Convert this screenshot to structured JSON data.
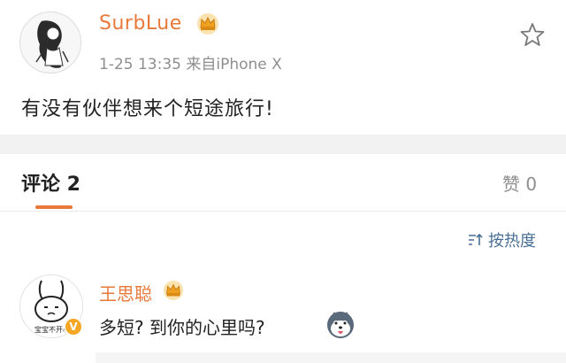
{
  "post": {
    "username": "SurbLue",
    "meta": "1-25 13:35  来自iPhone X",
    "text": "有没有伙伴想来个短途旅行!"
  },
  "comments_section": {
    "tab_label": "评论 2",
    "likes_label": "赞 0",
    "sort_label": "按热度"
  },
  "comment": {
    "name": "王思聪",
    "text": "多短? 到你的心里吗?",
    "avatar_caption": "宝宝不开心"
  },
  "colors": {
    "accent": "#e8793a",
    "link": "#4a6f96",
    "muted": "#8e8e8e",
    "band": "#f2f2f2",
    "badge": "#f5a623"
  },
  "icons": [
    "crown-badge-icon",
    "star-icon",
    "sort-icon",
    "verified-badge-icon",
    "husky-emoji-icon"
  ]
}
